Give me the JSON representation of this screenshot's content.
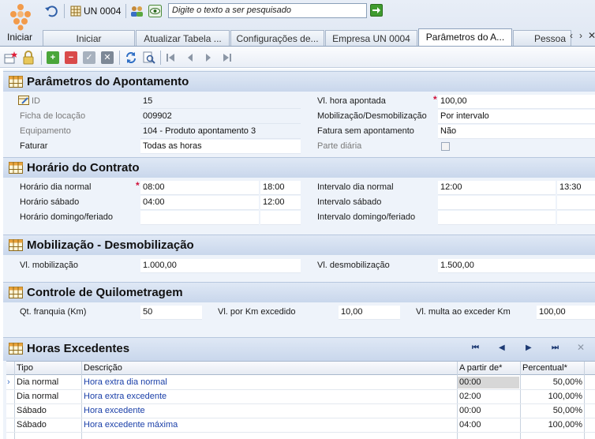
{
  "toolbar": {
    "iniciar_label": "Iniciar",
    "unit_label": "UN 0004",
    "search_placeholder": "Digite o texto a ser pesquisado"
  },
  "tabs": [
    {
      "label": "Iniciar"
    },
    {
      "label": "Atualizar Tabela ..."
    },
    {
      "label": "Configurações de..."
    },
    {
      "label": "Empresa UN 0004"
    },
    {
      "label": "Parâmetros do A..."
    },
    {
      "label": "Pessoa"
    }
  ],
  "sections": {
    "apontamento": {
      "title": "Parâmetros do Apontamento",
      "id_label": "ID",
      "id_value": "15",
      "ficha_label": "Ficha de locação",
      "ficha_value": "009902",
      "equip_label": "Equipamento",
      "equip_value": "104 - Produto apontamento 3",
      "faturar_label": "Faturar",
      "faturar_value": "Todas as horas",
      "vl_hora_label": "Vl. hora apontada",
      "vl_hora_value": "100,00",
      "mob_label": "Mobilização/Desmobilização",
      "mob_value": "Por intervalo",
      "fatura_sem_label": "Fatura sem apontamento",
      "fatura_sem_value": "Não",
      "parte_label": "Parte diária"
    },
    "horario": {
      "title": "Horário do Contrato",
      "dia_normal_label": "Horário dia normal",
      "dia_normal_ini": "08:00",
      "dia_normal_fim": "18:00",
      "sabado_label": "Horário sábado",
      "sabado_ini": "04:00",
      "sabado_fim": "12:00",
      "domingo_label": "Horário domingo/feriado",
      "domingo_ini": "",
      "domingo_fim": "",
      "int_dia_label": "Intervalo dia normal",
      "int_dia_ini": "12:00",
      "int_dia_fim": "13:30",
      "int_sab_label": "Intervalo sábado",
      "int_sab_ini": "",
      "int_sab_fim": "",
      "int_dom_label": "Intervalo domingo/feriado",
      "int_dom_ini": "",
      "int_dom_fim": ""
    },
    "mobilizacao": {
      "title": "Mobilização - Desmobilização",
      "vl_mob_label": "Vl. mobilização",
      "vl_mob_value": "1.000,00",
      "vl_desmob_label": "Vl. desmobilização",
      "vl_desmob_value": "1.500,00"
    },
    "quilometragem": {
      "title": "Controle de Quilometragem",
      "franquia_label": "Qt. franquia (Km)",
      "franquia_value": "50",
      "excedido_label": "Vl. por Km excedido",
      "excedido_value": "10,00",
      "multa_label": "Vl. multa ao exceder Km",
      "multa_value": "100,00"
    },
    "horas": {
      "title": "Horas Excedentes",
      "columns": [
        "Tipo",
        "Descrição",
        "A partir de*",
        "Percentual*"
      ],
      "rows": [
        {
          "tipo": "Dia normal",
          "descricao": "Hora extra dia normal",
          "a_partir": "00:00",
          "percentual": "50,00%"
        },
        {
          "tipo": "Dia normal",
          "descricao": "Hora extra excedente",
          "a_partir": "02:00",
          "percentual": "100,00%"
        },
        {
          "tipo": "Sábado",
          "descricao": "Hora excedente",
          "a_partir": "00:00",
          "percentual": "50,00%"
        },
        {
          "tipo": "Sábado",
          "descricao": "Hora excedente máxima",
          "a_partir": "04:00",
          "percentual": "100,00%"
        }
      ]
    }
  },
  "colors": {
    "accent": "#1a3fa8",
    "required": "#d0103a",
    "section_bg": "#c9d7ec",
    "panel_bg": "#eef3fa"
  }
}
